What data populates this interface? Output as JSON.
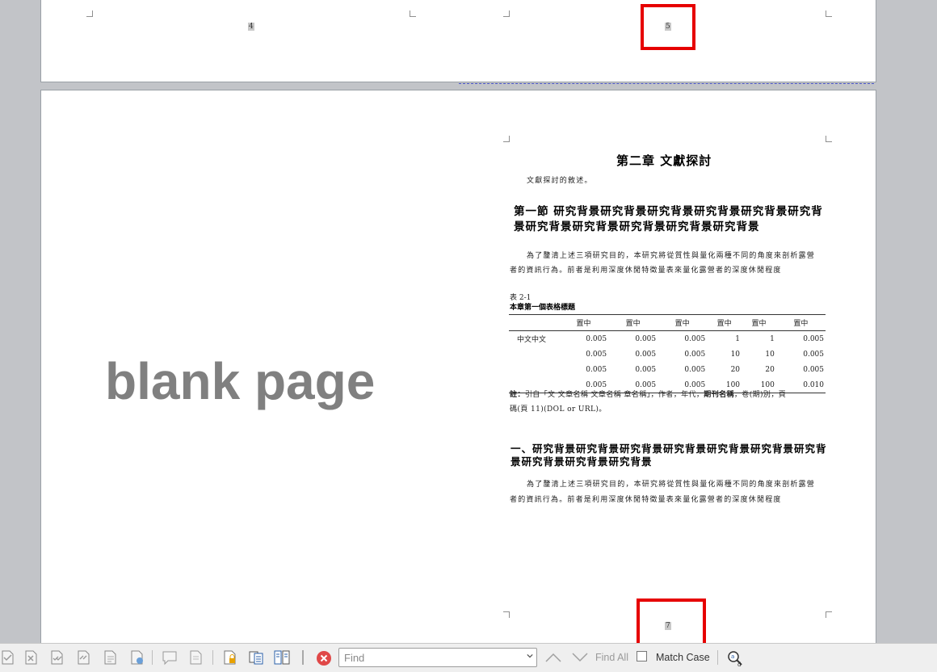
{
  "pages": {
    "page4_number": "4",
    "page5_number": "5",
    "page7_number": "7",
    "blank_label": "blank page"
  },
  "document": {
    "chapter_title": "第二章  文獻探討",
    "intro": "文獻探討的敘述。",
    "section_heading": "第一節  研究背景研究背景研究背景研究背景研究背景研究背景研究背景研究背景研究背景研究背景研究背景",
    "para1_line1": "為了釐清上述三項研究目的，本研究將從質性與量化兩種不同的角度來剖析露營",
    "para1_line2": "者的資訊行為。前者是利用深度休閒特徵量表來量化露營者的深度休閒程度",
    "table_label": "表 2-1",
    "table_title": "本章第一個表格標題",
    "table": {
      "headers": [
        "",
        "置中",
        "置中",
        "置中",
        "置中",
        "置中",
        "置中"
      ],
      "rows": [
        [
          "中文中文",
          "0.005",
          "0.005",
          "0.005",
          "1",
          "1",
          "0.005"
        ],
        [
          "",
          "0.005",
          "0.005",
          "0.005",
          "10",
          "10",
          "0.005"
        ],
        [
          "",
          "0.005",
          "0.005",
          "0.005",
          "20",
          "20",
          "0.005"
        ],
        [
          "",
          "0.005",
          "0.005",
          "0.005",
          "100",
          "100",
          "0.010"
        ]
      ]
    },
    "note_prefix": "註：",
    "note_text1": "引自「文 文章名稱 文章名稱 章名稱」，作者，年代，",
    "note_bold": "期刊名稱",
    "note_text2": "，卷(期)別，頁",
    "note_line2": "碼(頁 11)(DOL or URL)。",
    "subheading": "一、研究背景研究背景研究背景研究背景研究背景研究背景研究背景研究背景研究背景研究背景",
    "para2_line1": "為了釐清上述三項研究目的，本研究將從質性與量化兩種不同的角度來剖析露營",
    "para2_line2": "者的資訊行為。前者是利用深度休閒特徵量表來量化露營者的深度休閒程度"
  },
  "find_toolbar": {
    "find_placeholder": "Find",
    "find_all_label": "Find All",
    "match_case_label": "Match Case"
  },
  "colors": {
    "highlight": "#e60000",
    "workspace": "#c2c4c8"
  }
}
